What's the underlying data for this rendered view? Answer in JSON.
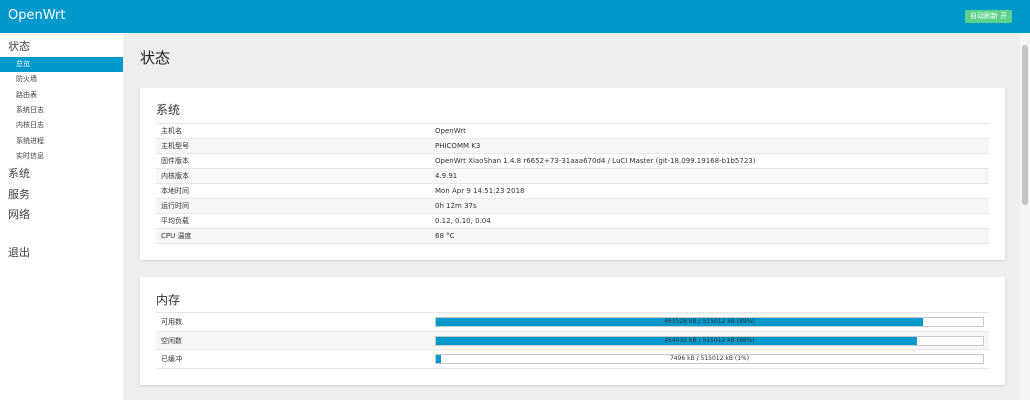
{
  "header": {
    "brand": "OpenWrt",
    "refresh_button": "自动刷新 开"
  },
  "sidebar": {
    "status_label": "状态",
    "status_items": [
      "总览",
      "防火墙",
      "路由表",
      "系统日志",
      "内核日志",
      "系统进程",
      "实时信息"
    ],
    "active_item": "总览",
    "other_items": [
      "系统",
      "服务",
      "网络"
    ],
    "logout_label": "退出"
  },
  "page_title": "状态",
  "system": {
    "title": "系统",
    "rows": [
      {
        "key": "主机名",
        "value": "OpenWrt"
      },
      {
        "key": "主机型号",
        "value": "PHICOMM K3"
      },
      {
        "key": "固件版本",
        "value": "OpenWrt XiaoShan 1.4.8 r6652+73-31aaa670d4 / LuCI Master (git-18.099.19168-b1b5723)"
      },
      {
        "key": "内核版本",
        "value": "4.9.91"
      },
      {
        "key": "本地时间",
        "value": "Mon Apr 9 14:51:23 2018"
      },
      {
        "key": "运行时间",
        "value": "0h 12m 37s"
      },
      {
        "key": "平均负载",
        "value": "0.12, 0.10, 0.04"
      },
      {
        "key": "CPU 温度",
        "value": "68 °C"
      }
    ]
  },
  "memory": {
    "title": "内存",
    "rows": [
      {
        "key": "可用数",
        "text": "461528 kB / 515012 kB (89%)",
        "fraction": 0.89
      },
      {
        "key": "空闲数",
        "text": "454032 kB / 515012 kB (88%)",
        "fraction": 0.88
      },
      {
        "key": "已缓冲",
        "text": "7496 kB / 515012 kB (1%)",
        "fraction": 0.01
      }
    ]
  },
  "colors": {
    "accent": "#0099cc",
    "refresh_button": "#5cd18a",
    "background": "#eeeeee"
  }
}
